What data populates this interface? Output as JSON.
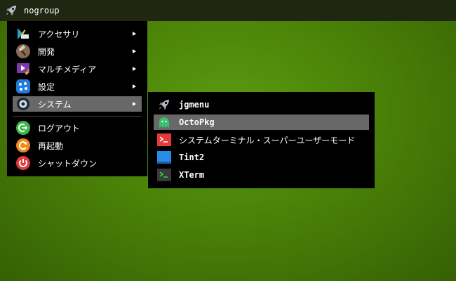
{
  "taskbar": {
    "title": "nogroup",
    "logo_icon": "rocket-icon"
  },
  "main_menu": {
    "items": [
      {
        "label": "アクセサリ",
        "icon": "accessories-icon",
        "submenu": true
      },
      {
        "label": "開発",
        "icon": "development-hammer-icon",
        "submenu": true
      },
      {
        "label": "マルチメディア",
        "icon": "multimedia-icon",
        "submenu": true
      },
      {
        "label": "設定",
        "icon": "settings-icon",
        "submenu": true
      },
      {
        "label": "システム",
        "icon": "system-gear-icon",
        "submenu": true,
        "selected": true
      }
    ],
    "actions": [
      {
        "label": "ログアウト",
        "icon": "logout-icon"
      },
      {
        "label": "再起動",
        "icon": "restart-icon"
      },
      {
        "label": "シャットダウン",
        "icon": "power-icon"
      }
    ]
  },
  "submenu": {
    "items": [
      {
        "label": "jgmenu",
        "icon": "rocket-icon"
      },
      {
        "label": "OctoPkg",
        "icon": "octopkg-icon",
        "selected": true
      },
      {
        "label": "システムターミナル・スーパーユーザーモード",
        "icon": "root-terminal-icon"
      },
      {
        "label": "Tint2",
        "icon": "tint2-panel-icon"
      },
      {
        "label": "XTerm",
        "icon": "xterm-icon"
      }
    ]
  },
  "colors": {
    "desktop": "#4a8208",
    "menu_bg": "#000000",
    "selection": "#686868",
    "topbar": "#1f2612"
  }
}
